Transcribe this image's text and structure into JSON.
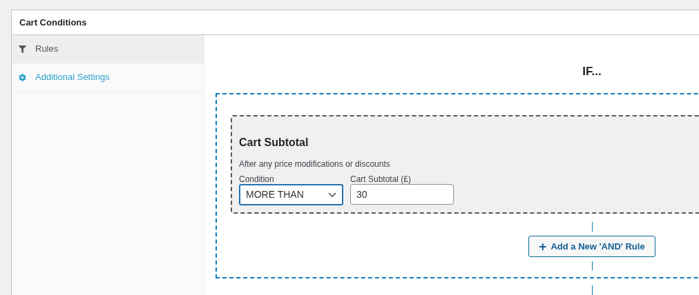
{
  "panel": {
    "title": "Cart Conditions"
  },
  "sidebar": {
    "items": [
      {
        "label": "Rules",
        "selected": true
      },
      {
        "label": "Additional Settings",
        "selected": false
      }
    ]
  },
  "main": {
    "heading": "IF...",
    "rule": {
      "title": "Cart Subtotal",
      "description": "After any price modifications or discounts",
      "condition": {
        "label": "Condition",
        "value": "MORE THAN"
      },
      "amount": {
        "label": "Cart Subtotal (£)",
        "value": "30"
      }
    },
    "add_button": {
      "icon": "+",
      "label": "Add a New 'AND' Rule"
    }
  }
}
